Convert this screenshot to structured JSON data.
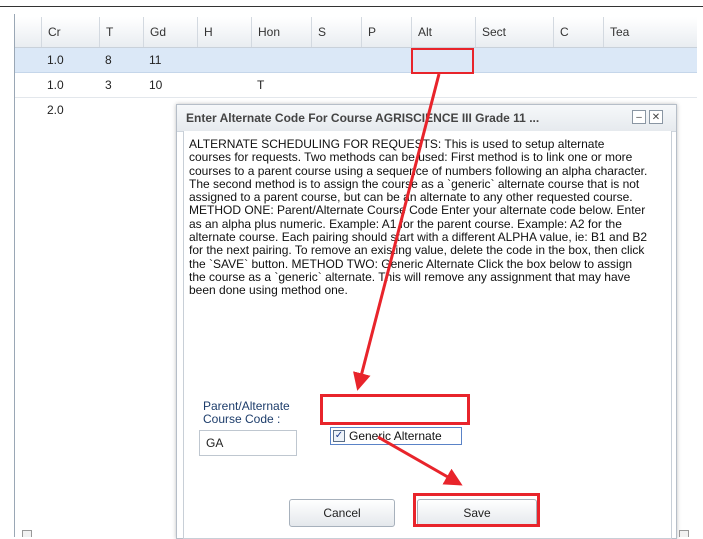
{
  "grid": {
    "columns": [
      "Cr",
      "T",
      "Gd",
      "H",
      "Hon",
      "S",
      "P",
      "Alt",
      "Sect",
      "C",
      "Tea"
    ],
    "rows": [
      {
        "cr": "1.0",
        "t": "8",
        "gd": "11",
        "h": "",
        "hon": "",
        "selected": true
      },
      {
        "cr": "1.0",
        "t": "3",
        "gd": "10",
        "h": "",
        "hon": "T",
        "selected": false
      },
      {
        "cr": "2.0",
        "t": "",
        "gd": "",
        "h": "",
        "hon": "",
        "selected": false
      }
    ]
  },
  "dialog": {
    "title": "Enter Alternate Code For Course AGRISCIENCE III Grade 11 ...",
    "minimize_icon": "minimize-icon",
    "close_icon": "close-icon",
    "description": "ALTERNATE SCHEDULING FOR REQUESTS: This is used to setup alternate courses for requests. Two methods can be used: First method is to link one or more courses to a parent course using a sequence of numbers following an alpha character. The second method is to assign the course as a `generic` alternate course that is not assigned to a parent course, but can be an alternate to any other requested course. METHOD ONE: Parent/Alternate Course Code Enter your alternate code below. Enter as an alpha plus numeric. Example: A1 for the parent course. Example: A2 for the alternate course. Each pairing should start with a different ALPHA value, ie: B1 and B2 for the next pairing. To remove an existing value, delete the code in the box, then click the `SAVE` button. METHOD TWO: Generic Alternate Click the box below to assign the course as a `generic` alternate. This will remove any assignment that may have been done using method one.",
    "code_label": "Parent/Alternate Course Code :",
    "code_value": "GA",
    "generic_label": "Generic Alternate",
    "generic_checked": true,
    "cancel_label": "Cancel",
    "save_label": "Save"
  },
  "annotations": {
    "highlight_color": "#e8242b"
  }
}
